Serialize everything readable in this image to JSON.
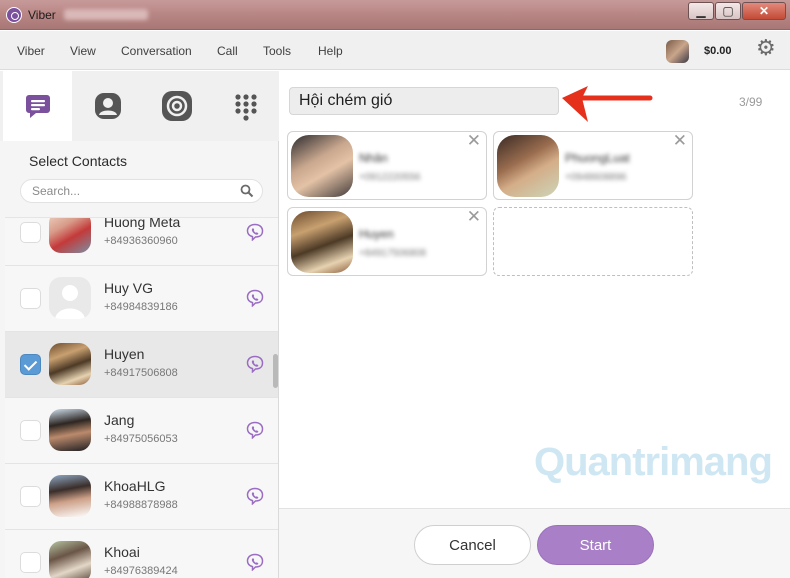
{
  "window": {
    "title": "Viber",
    "controls": {
      "minimize": "▁",
      "maximize": "▢",
      "close": "✕"
    }
  },
  "menu": {
    "items": [
      "Viber",
      "View",
      "Conversation",
      "Call",
      "Tools",
      "Help"
    ],
    "balance": "$0.00",
    "settings_icon": "gear-icon"
  },
  "sidebar": {
    "tabs": [
      {
        "icon": "chat-icon",
        "active": true
      },
      {
        "icon": "contacts-icon",
        "active": false
      },
      {
        "icon": "public-chats-icon",
        "active": false
      },
      {
        "icon": "dialpad-icon",
        "active": false
      }
    ],
    "section_title": "Select Contacts",
    "search_placeholder": "Search...",
    "contacts": [
      {
        "name": "Huong Meta",
        "phone": "+84936360960",
        "checked": false
      },
      {
        "name": "Huy VG",
        "phone": "+84984839186",
        "checked": false
      },
      {
        "name": "Huyen",
        "phone": "+84917506808",
        "checked": true
      },
      {
        "name": "Jang",
        "phone": "+84975056053",
        "checked": false
      },
      {
        "name": "KhoaHLG",
        "phone": "+84988878988",
        "checked": false
      },
      {
        "name": "Khoai",
        "phone": "+84976389424",
        "checked": false
      }
    ]
  },
  "main": {
    "group_name": "Hội chém gió",
    "counter": "3/99",
    "members": [
      {
        "name": "Nhân",
        "phone": "+0912220556"
      },
      {
        "name": "PhuongLuat",
        "phone": "+0948608896"
      },
      {
        "name": "Huyen",
        "phone": "+84917506808"
      }
    ],
    "remove_icon": "✕",
    "watermark": {
      "main": "Quantri",
      "accent": "mang"
    },
    "cancel_label": "Cancel",
    "start_label": "Start"
  },
  "colors": {
    "accent_purple": "#a980c8",
    "viber_purple": "#7b519d",
    "check_blue": "#5a9bd5",
    "arrow_red": "#e5301c"
  }
}
